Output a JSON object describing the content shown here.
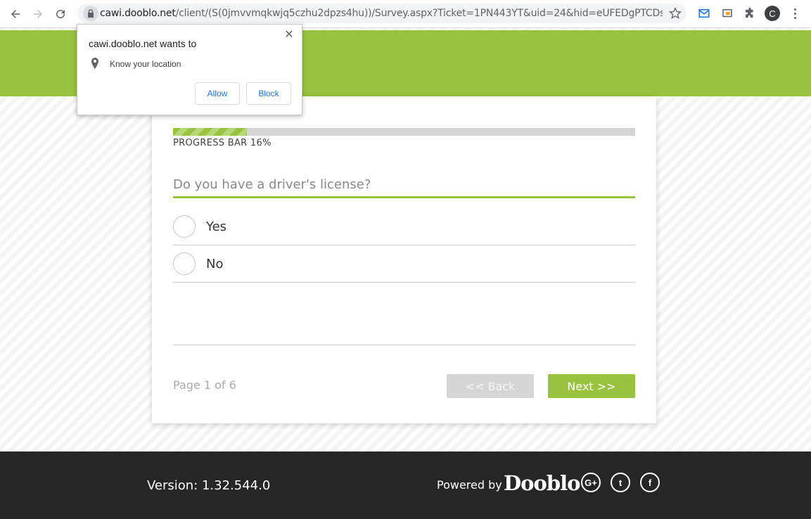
{
  "browser": {
    "url_host": "cawi.dooblo.net",
    "url_path": "/client/(S(0jmvvmqkwjq5czhu2dpzs4hu))/Survey.aspx?Ticket=1PN443YT&uid=24&hid=eUFEDgPTCDso83ollaLjZ...",
    "profile_initial": "C"
  },
  "permission_popup": {
    "title": "cawi.dooblo.net wants to",
    "permission": "Know your location",
    "allow_label": "Allow",
    "block_label": "Block",
    "close_glyph": "✕"
  },
  "survey": {
    "progress_label": "PROGRESS BAR 16%",
    "progress_fraction": 0.16,
    "question": "Do you have a driver's license?",
    "options": [
      {
        "label": "Yes"
      },
      {
        "label": "No"
      }
    ],
    "page_indicator": "Page 1 of 6",
    "back_label": "<< Back",
    "next_label": "Next >>"
  },
  "footer": {
    "version": "Version: 1.32.544.0",
    "powered_by": "Powered by",
    "logo_text": "Dooblo",
    "social": [
      {
        "icon": "google-plus-icon",
        "glyph": "G+"
      },
      {
        "icon": "twitter-icon",
        "glyph": "t"
      },
      {
        "icon": "facebook-icon",
        "glyph": "f"
      }
    ]
  },
  "colors": {
    "accent": "#98c33f",
    "footer_bg": "#262626"
  }
}
